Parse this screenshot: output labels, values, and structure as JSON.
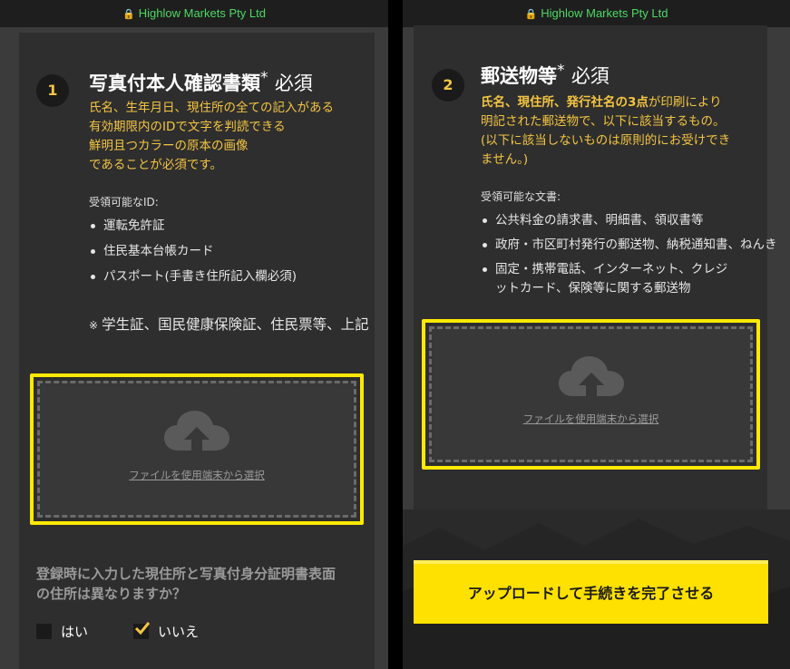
{
  "browser": {
    "url_text": "Highlow Markets Pty Ltd"
  },
  "section1": {
    "number": "1",
    "title": "写真付本人確認書類",
    "star": "*",
    "required": "必須",
    "description": [
      "氏名、生年月日、現住所の全ての記入がある",
      "有効期限内のIDで文字を判読できる",
      "鮮明且つカラーの原本の画像",
      "であることが必須です。"
    ],
    "accepted_label": "受領可能なID:",
    "accepted_items": [
      "運転免許証",
      "住民基本台帳カード",
      "パスポート(手書き住所記入欄必須)"
    ],
    "note_mark": "※",
    "note_text": "学生証、国民健康保険証、住民票等、上記",
    "upload_text": "ファイルを使用端末から選択",
    "upload_icon": "cloud-upload-icon"
  },
  "question": {
    "line1": "登録時に入力した現住所と写真付身分証明書表面",
    "line2": "の住所は異なりますか？",
    "yes_label": "はい",
    "no_label": "いいえ",
    "selected": "いいえ"
  },
  "section2": {
    "number": "2",
    "title": "郵送物等",
    "star": "*",
    "required": "必須",
    "desc_bold": "氏名、現住所、発行社名の3点",
    "desc_line1_rest": "が印刷により",
    "desc_line2": "明記された郵送物で、以下に該当するもの。",
    "desc_line3": "(以下に該当しないものは原則的にお受けでき",
    "desc_line4": "ません。)",
    "accepted_label": "受領可能な文書:",
    "accepted_items": [
      "公共料金の請求書、明細書、領収書等",
      "政府・市区町村発行の郵送物、納税通知書、ねんき"
    ],
    "item3_line1": "固定・携帯電話、インターネット、クレジ",
    "item3_line2": "ットカード、保険等に関する郵送物",
    "upload_text": "ファイルを使用端末から選択",
    "upload_icon": "cloud-upload-icon"
  },
  "submit": {
    "label": "アップロードして手続きを完了させる"
  },
  "colors": {
    "accent_yellow": "#ffe900",
    "text_yellow": "#f4c542",
    "secure_green": "#4cd964",
    "panel_dark": "#2e2e2e"
  }
}
